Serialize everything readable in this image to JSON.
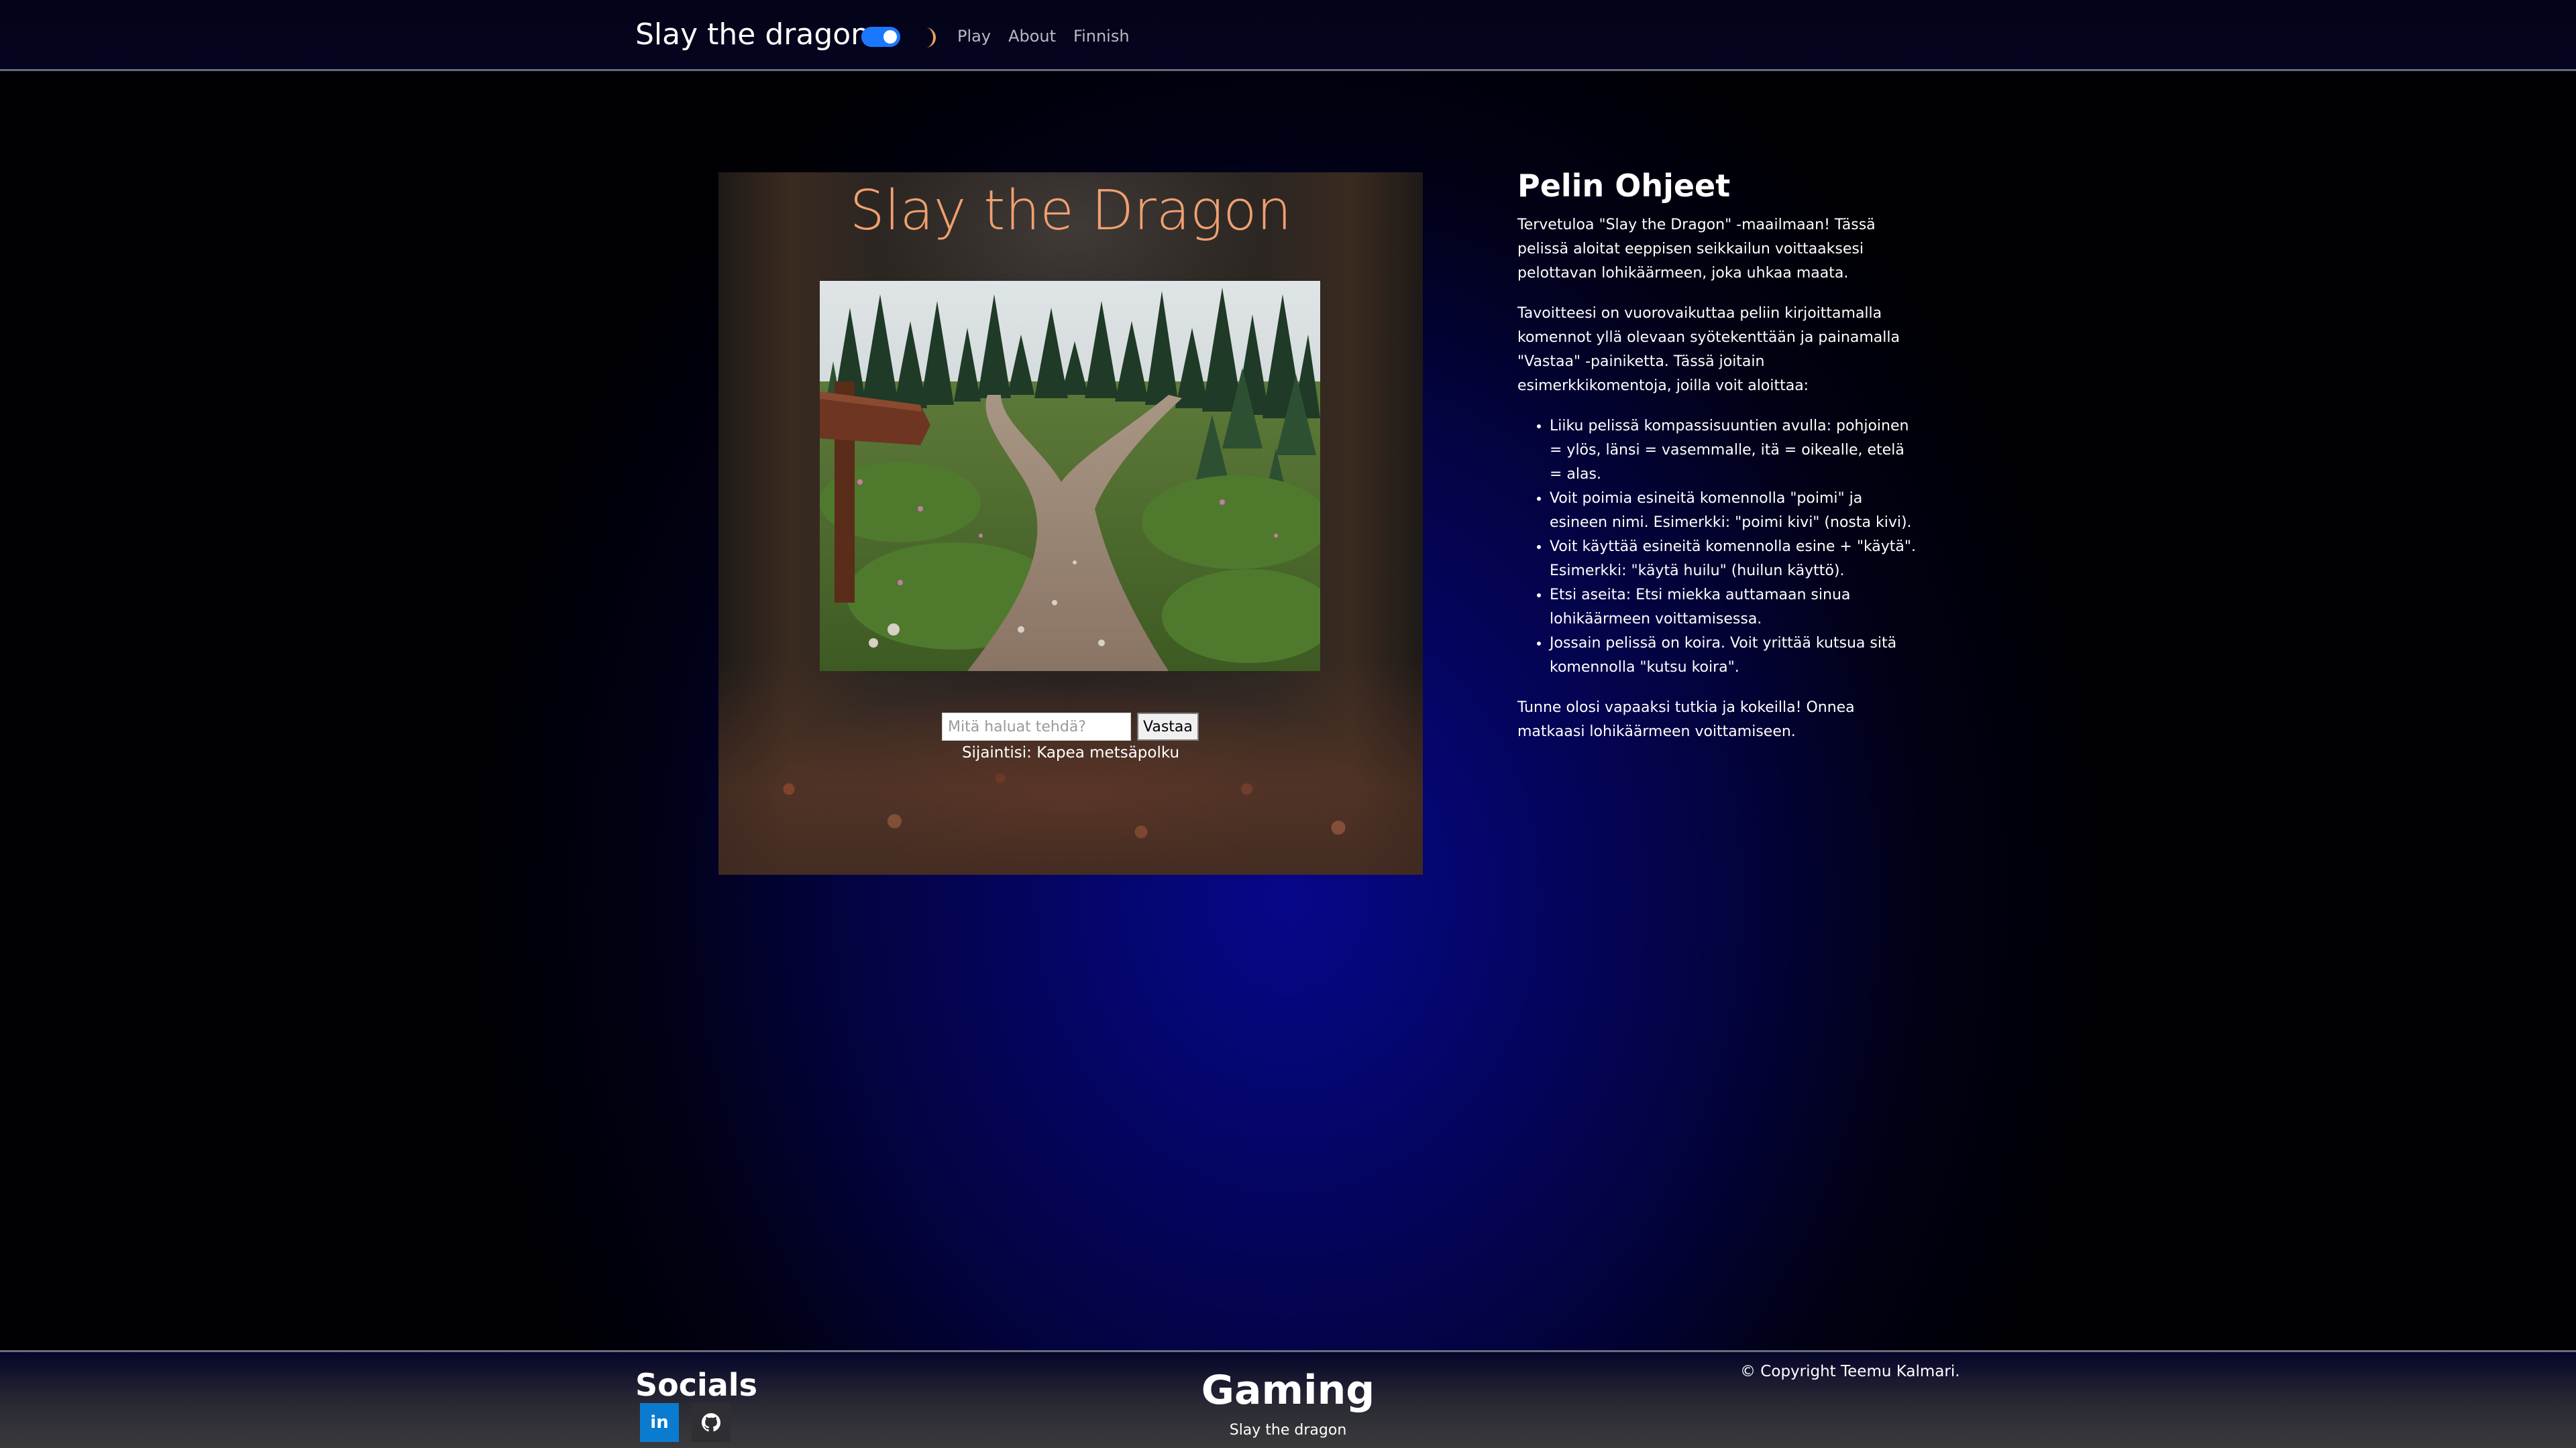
{
  "navbar": {
    "brand": "Slay the dragon",
    "links": [
      "Play",
      "About",
      "Finnish"
    ],
    "theme_toggle_on": true,
    "accent_color": "#1a78ff",
    "moon_color": "#f0a060"
  },
  "game": {
    "title": "Slay the Dragon",
    "title_color": "#f0a070",
    "scene_image": "forest-path-fork",
    "input_placeholder": "Mitä haluat tehdä?",
    "input_value": "",
    "submit_label": "Vastaa",
    "location_text": "Sijaintisi: Kapea metsäpolku"
  },
  "instructions": {
    "heading": "Pelin Ohjeet",
    "intro": "Tervetuloa \"Slay the Dragon\" -maailmaan! Tässä pelissä aloitat eeppisen seikkailun voittaaksesi pelottavan lohikäärmeen, joka uhkaa maata.",
    "goal": "Tavoitteesi on vuorovaikuttaa peliin kirjoittamalla komennot yllä olevaan syötekenttään ja painamalla \"Vastaa\" -painiketta. Tässä joitain esimerkkikomentoja, joilla voit aloittaa:",
    "items": [
      "Liiku pelissä kompassisuuntien avulla: pohjoinen = ylös, länsi = vasemmalle, itä = oikealle, etelä = alas.",
      "Voit poimia esineitä komennolla \"poimi\" ja esineen nimi. Esimerkki: \"poimi kivi\" (nosta kivi).",
      "Voit käyttää esineitä komennolla esine + \"käytä\". Esimerkki: \"käytä huilu\" (huilun käyttö).",
      "Etsi aseita: Etsi miekka auttamaan sinua lohikäärmeen voittamisessa.",
      "Jossain pelissä on koira. Voit yrittää kutsua sitä komennolla \"kutsu koira\"."
    ],
    "outro": "Tunne olosi vapaaksi tutkia ja kokeilla! Onnea matkaasi lohikäärmeen voittamiseen."
  },
  "footer": {
    "socials_title": "Socials",
    "social_icons": [
      "linkedin-icon",
      "github-icon"
    ],
    "linkedin_label": "in",
    "linkedin_color": "#0b7bd0",
    "gaming_title": "Gaming",
    "gaming_subtitle": "Slay the dragon",
    "copyright": "© Copyright Teemu Kalmari."
  }
}
